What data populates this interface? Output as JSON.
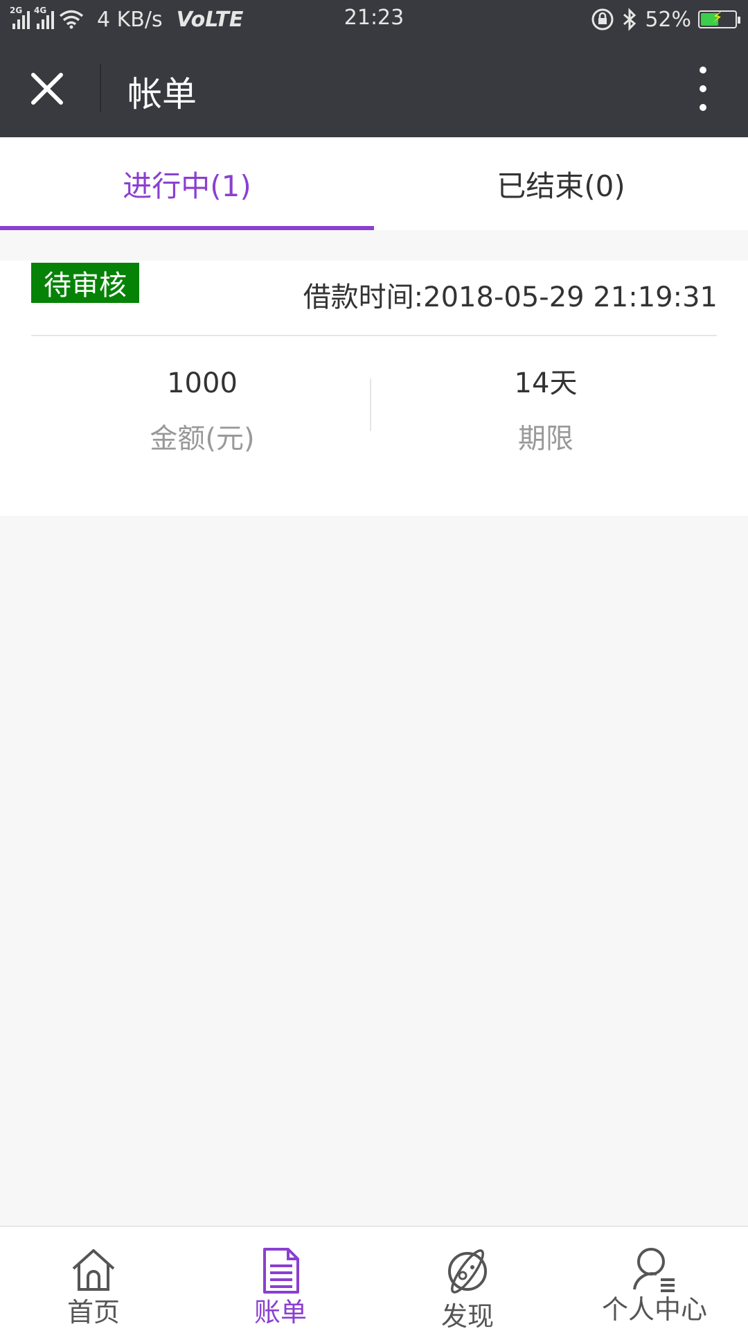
{
  "status_bar": {
    "signal1_tag": "2G",
    "signal2_tag": "4G",
    "speed": "4 KB/s",
    "volte": "VoLTE",
    "time": "21:23",
    "battery": "52%",
    "battery_level": 0.52
  },
  "header": {
    "title": "帐单",
    "close_icon": "close-icon",
    "more_icon": "more-vertical-icon"
  },
  "tabs": [
    {
      "label": "进行中(1)",
      "active": true
    },
    {
      "label": "已结束(0)",
      "active": false
    }
  ],
  "bill": {
    "status_badge": "待审核",
    "loan_time": "借款时间:2018-05-29 21:19:31",
    "amount_value": "1000",
    "amount_label": "金额(元)",
    "term_value": "14天",
    "term_label": "期限"
  },
  "bottom_nav": [
    {
      "label": "首页",
      "icon": "home-icon",
      "active": false
    },
    {
      "label": "账单",
      "icon": "bill-icon",
      "active": true
    },
    {
      "label": "发现",
      "icon": "planet-icon",
      "active": false
    },
    {
      "label": "个人中心",
      "icon": "user-icon",
      "active": false
    }
  ],
  "colors": {
    "header_bg": "#393a3f",
    "accent": "#8a3fd1",
    "badge_green": "#068306",
    "page_bg": "#f7f7f7"
  }
}
